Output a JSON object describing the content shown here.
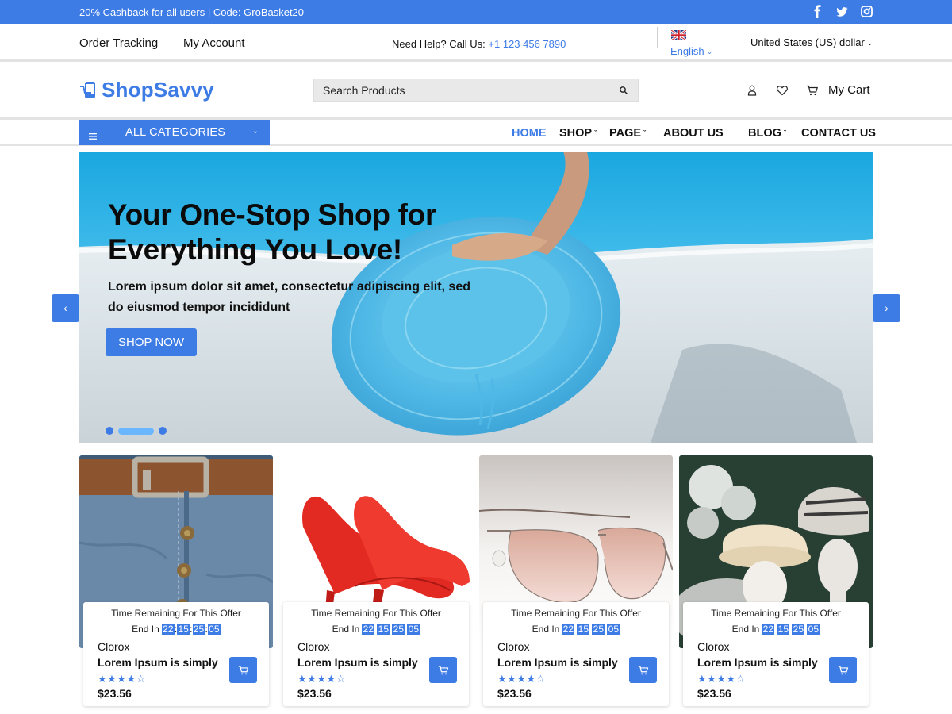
{
  "topbar": {
    "promo": "20% Cashback for all users | Code: GroBasket20",
    "social": [
      "facebook-icon",
      "twitter-icon",
      "instagram-icon"
    ]
  },
  "subbar": {
    "order_tracking": "Order Tracking",
    "my_account": "My Account",
    "help_prefix": "Need Help? Call Us: ",
    "phone": "+1 123 456 7890",
    "language": "English",
    "currency": "United States (US) dollar"
  },
  "header": {
    "logo": "ShopSavvy",
    "search_placeholder": "Search Products",
    "cart_label": "My Cart"
  },
  "nav": {
    "all_categories": "ALL CATEGORIES",
    "items": [
      {
        "label": "HOME",
        "active": true
      },
      {
        "label": "SHOP",
        "dropdown": true
      },
      {
        "label": "PAGE",
        "dropdown": true
      },
      {
        "label": "ABOUT US"
      },
      {
        "label": "BLOG",
        "dropdown": true
      },
      {
        "label": "CONTACT US"
      }
    ]
  },
  "hero": {
    "title": "Your One-Stop Shop for Everything You Love!",
    "subtitle": "Lorem ipsum dolor sit amet, consectetur adipiscing elit, sed do eiusmod tempor incididunt",
    "cta": "SHOP NOW",
    "prev": "‹",
    "next": "›",
    "slides": 3,
    "active_slide": 2
  },
  "products": [
    {
      "image": "jeans-belt",
      "timer_title": "Time Remaining For This Offer",
      "end_in": "End In",
      "timer": [
        "22",
        "15",
        "25",
        "05"
      ],
      "timer_colons": true,
      "brand": "Clorox",
      "name": "Lorem Ipsum is simply",
      "rating": 4,
      "rating_max": 5,
      "price": "$23.56"
    },
    {
      "image": "red-heels",
      "timer_title": "Time Remaining For This Offer",
      "end_in": "End In",
      "timer": [
        "22",
        "15",
        "25",
        "05"
      ],
      "timer_colons": false,
      "brand": "Clorox",
      "name": "Lorem Ipsum is simply",
      "rating": 4,
      "rating_max": 5,
      "price": "$23.56"
    },
    {
      "image": "sunglasses",
      "timer_title": "Time Remaining For This Offer",
      "end_in": "End In",
      "timer": [
        "22",
        "15",
        "25",
        "05"
      ],
      "timer_colons": false,
      "brand": "Clorox",
      "name": "Lorem Ipsum is simply",
      "rating": 4,
      "rating_max": 5,
      "price": "$23.56"
    },
    {
      "image": "hats-mannequins",
      "timer_title": "Time Remaining For This Offer",
      "end_in": "End In",
      "timer": [
        "22",
        "15",
        "25",
        "05"
      ],
      "timer_colons": false,
      "brand": "Clorox",
      "name": "Lorem Ipsum is simply",
      "rating": 4,
      "rating_max": 5,
      "price": "$23.56"
    }
  ],
  "colors": {
    "accent": "#3d7be5",
    "accent_light": "#6ab6ff",
    "text": "#111111",
    "divider": "#e3e3e3"
  }
}
